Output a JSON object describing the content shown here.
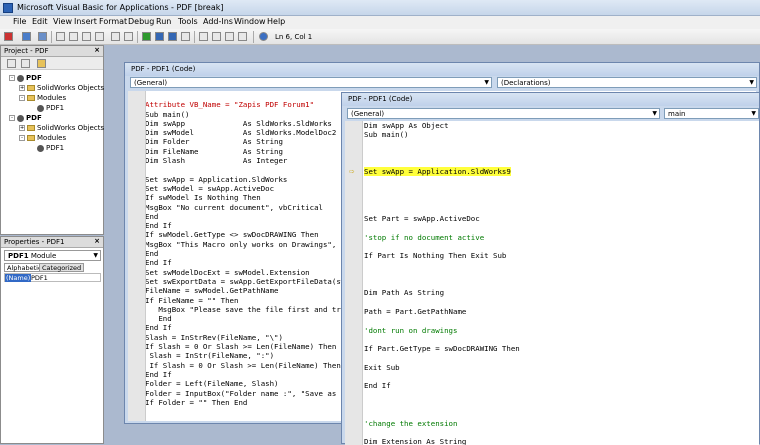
{
  "window": {
    "title": "Microsoft Visual Basic for Applications - PDF [break]"
  },
  "menu": [
    "File",
    "Edit",
    "View",
    "Insert",
    "Format",
    "Debug",
    "Run",
    "Tools",
    "Add-Ins",
    "Window",
    "Help"
  ],
  "toolbar": {
    "position": "Ln 6, Col 1"
  },
  "project": {
    "title": "Project - PDF",
    "tree": [
      {
        "label": "PDF",
        "level": 0
      },
      {
        "label": "SolidWorks Objects",
        "level": 1
      },
      {
        "label": "Modules",
        "level": 1
      },
      {
        "label": "PDF1",
        "level": 2
      },
      {
        "label": "PDF",
        "level": 0
      },
      {
        "label": "SolidWorks Objects",
        "level": 1
      },
      {
        "label": "Modules",
        "level": 1
      },
      {
        "label": "PDF1",
        "level": 2
      }
    ]
  },
  "properties": {
    "title": "Properties - PDF1",
    "object": "PDF1",
    "object_type": "Module",
    "tabs": [
      "Alphabetic",
      "Categorized"
    ],
    "rows": [
      {
        "name": "(Name)",
        "value": "PDF1"
      }
    ]
  },
  "back_window": {
    "title": "PDF - PDF1 (Code)",
    "left_combo": "(General)",
    "right_combo": "(Declarations)",
    "lines": [
      {
        "text": "",
        "cls": ""
      },
      {
        "text": "Attribute VB_Name = \"Zapis PDF Forum1\"",
        "cls": "at"
      },
      {
        "text": "Sub main()",
        "cls": ""
      },
      {
        "text": "Dim swApp             As SldWorks.SldWorks",
        "cls": ""
      },
      {
        "text": "Dim swModel           As SldWorks.ModelDoc2",
        "cls": ""
      },
      {
        "text": "Dim Folder            As String",
        "cls": ""
      },
      {
        "text": "Dim FileName          As String",
        "cls": ""
      },
      {
        "text": "Dim Slash             As Integer",
        "cls": ""
      },
      {
        "text": "",
        "cls": ""
      },
      {
        "text": "Set swApp = Application.SldWorks",
        "cls": ""
      },
      {
        "text": "Set swModel = swApp.ActiveDoc",
        "cls": ""
      },
      {
        "text": "If swModel Is Nothing Then",
        "cls": ""
      },
      {
        "text": "MsgBox \"No current document\", vbCritical",
        "cls": ""
      },
      {
        "text": "End",
        "cls": ""
      },
      {
        "text": "End If",
        "cls": ""
      },
      {
        "text": "If swModel.GetType <> swDocDRAWING Then",
        "cls": ""
      },
      {
        "text": "MsgBox \"This Macro only works on Drawings\", v",
        "cls": ""
      },
      {
        "text": "End",
        "cls": ""
      },
      {
        "text": "End If",
        "cls": ""
      },
      {
        "text": "Set swModelDocExt = swModel.Extension",
        "cls": ""
      },
      {
        "text": "Set swExportData = swApp.GetExportFileData(sw",
        "cls": ""
      },
      {
        "text": "FileName = swModel.GetPathName",
        "cls": ""
      },
      {
        "text": "If FileName = \"\" Then",
        "cls": ""
      },
      {
        "text": "   MsgBox \"Please save the file first and try",
        "cls": ""
      },
      {
        "text": "   End",
        "cls": ""
      },
      {
        "text": "End If",
        "cls": ""
      },
      {
        "text": "Slash = InStrRev(FileName, \"\\\")",
        "cls": ""
      },
      {
        "text": "If Slash = 0 Or Slash >= Len(FileName) Then",
        "cls": ""
      },
      {
        "text": " Slash = InStr(FileName, \":\")",
        "cls": ""
      },
      {
        "text": " If Slash = 0 Or Slash >= Len(FileName) Then",
        "cls": ""
      },
      {
        "text": "End If",
        "cls": ""
      },
      {
        "text": "Folder = Left(FileName, Slash)",
        "cls": ""
      },
      {
        "text": "Folder = InputBox(\"Folder name :\", \"Save as P",
        "cls": ""
      },
      {
        "text": "If Folder = \"\" Then End",
        "cls": ""
      }
    ]
  },
  "front_window": {
    "title": "PDF - PDF1 (Code)",
    "left_combo": "(General)",
    "right_combo": "main",
    "lines": [
      {
        "text": "Dim swApp As Object",
        "cls": ""
      },
      {
        "text": "Sub main()",
        "cls": ""
      },
      {
        "text": "",
        "cls": ""
      },
      {
        "text": "",
        "cls": ""
      },
      {
        "text": "",
        "cls": ""
      },
      {
        "text": "Set swApp = Application.SldWorks9",
        "cls": "hl"
      },
      {
        "text": "",
        "cls": ""
      },
      {
        "text": "",
        "cls": ""
      },
      {
        "text": "",
        "cls": ""
      },
      {
        "text": "",
        "cls": ""
      },
      {
        "text": "Set Part = swApp.ActiveDoc",
        "cls": ""
      },
      {
        "text": "",
        "cls": ""
      },
      {
        "text": "'stop if no document active",
        "cls": "cm"
      },
      {
        "text": "",
        "cls": ""
      },
      {
        "text": "If Part Is Nothing Then Exit Sub",
        "cls": ""
      },
      {
        "text": "",
        "cls": ""
      },
      {
        "text": "",
        "cls": ""
      },
      {
        "text": "",
        "cls": ""
      },
      {
        "text": "Dim Path As String",
        "cls": ""
      },
      {
        "text": "",
        "cls": ""
      },
      {
        "text": "Path = Part.GetPathName",
        "cls": ""
      },
      {
        "text": "",
        "cls": ""
      },
      {
        "text": "'dont run on drawings",
        "cls": "cm"
      },
      {
        "text": "",
        "cls": ""
      },
      {
        "text": "If Part.GetType = swDocDRAWING Then",
        "cls": ""
      },
      {
        "text": "",
        "cls": ""
      },
      {
        "text": "Exit Sub",
        "cls": ""
      },
      {
        "text": "",
        "cls": ""
      },
      {
        "text": "End If",
        "cls": ""
      },
      {
        "text": "",
        "cls": ""
      },
      {
        "text": "",
        "cls": ""
      },
      {
        "text": "",
        "cls": ""
      },
      {
        "text": "'change the extension",
        "cls": "cm"
      },
      {
        "text": "",
        "cls": ""
      },
      {
        "text": "Dim Extension As String",
        "cls": ""
      }
    ]
  }
}
